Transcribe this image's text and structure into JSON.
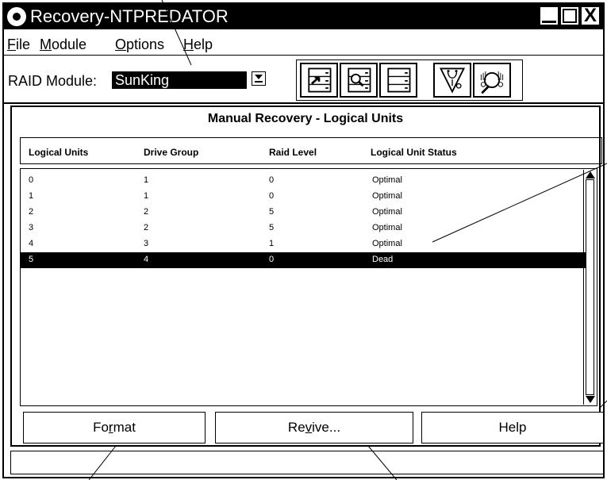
{
  "window": {
    "title": "Recovery-NTPREDATOR",
    "close_glyph": "X"
  },
  "menu": [
    {
      "label": "File",
      "mnemonic": "F",
      "rest": "ile"
    },
    {
      "label": "Module",
      "mnemonic": "M",
      "rest": "odule"
    },
    {
      "label": "Options",
      "mnemonic": "O",
      "rest": "ptions"
    },
    {
      "label": "Help",
      "mnemonic": "H",
      "rest": "elp"
    }
  ],
  "toolbar": {
    "raid_label": "RAID Module:",
    "raid_value": "SunKing",
    "icons": [
      "configuration-icon",
      "status-icon",
      "recovery-icon",
      "maintenance-icon",
      "about-icon"
    ]
  },
  "panel": {
    "title": "Manual Recovery - Logical Units",
    "columns": [
      "Logical Units",
      "Drive Group",
      "Raid Level",
      "Logical Unit Status"
    ],
    "rows": [
      {
        "lun": "0",
        "group": "1",
        "level": "0",
        "status": "Optimal",
        "selected": false
      },
      {
        "lun": "1",
        "group": "1",
        "level": "0",
        "status": "Optimal",
        "selected": false
      },
      {
        "lun": "2",
        "group": "2",
        "level": "5",
        "status": "Optimal",
        "selected": false
      },
      {
        "lun": "3",
        "group": "2",
        "level": "5",
        "status": "Optimal",
        "selected": false
      },
      {
        "lun": "4",
        "group": "3",
        "level": "1",
        "status": "Optimal",
        "selected": false
      },
      {
        "lun": "5",
        "group": "4",
        "level": "0",
        "status": "Dead",
        "selected": true
      }
    ]
  },
  "buttons": {
    "format": {
      "before": "Fo",
      "mnemonic": "r",
      "after": "mat"
    },
    "revive": {
      "before": "Re",
      "mnemonic": "v",
      "after": "ive..."
    },
    "help": {
      "label": "Help"
    }
  }
}
